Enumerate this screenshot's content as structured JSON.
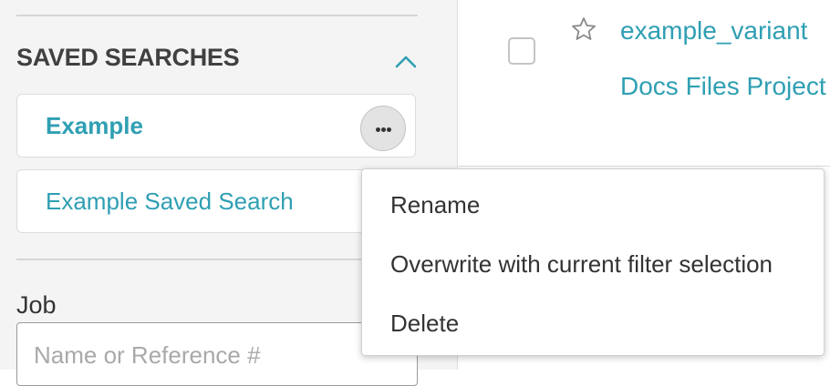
{
  "sidebar": {
    "saved_searches": {
      "title": "SAVED SEARCHES",
      "items": [
        {
          "label": "Example"
        },
        {
          "label": "Example Saved Search"
        }
      ]
    },
    "job_filter": {
      "label": "Job",
      "placeholder": "Name or Reference #",
      "value": ""
    }
  },
  "results": {
    "rows": [
      {
        "title": "example_variant",
        "project": "Docs Files Project",
        "starred": false,
        "checked": false
      }
    ]
  },
  "context_menu": {
    "items": [
      {
        "label": "Rename"
      },
      {
        "label": "Overwrite with current filter selection"
      },
      {
        "label": "Delete"
      }
    ]
  },
  "colors": {
    "accent": "#2f9fb3",
    "sidebar_bg": "#f4f4f4",
    "text": "#333333",
    "heading": "#404040",
    "placeholder": "#a9a9a9",
    "border": "#dcdcdc"
  },
  "icons": {
    "collapse": "chevron-up-icon",
    "more": "ellipsis-icon",
    "star": "star-outline-icon"
  }
}
